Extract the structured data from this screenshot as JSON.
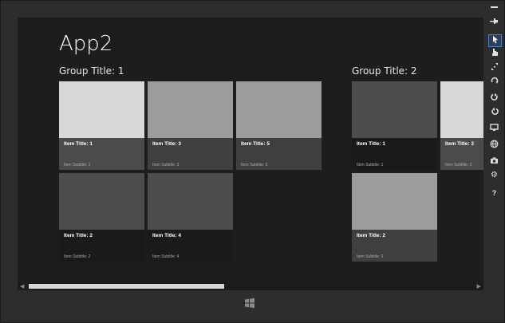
{
  "app": {
    "title": "App2"
  },
  "groups": [
    {
      "title": "Group Title: 1",
      "items": [
        {
          "title": "Item Title: 1",
          "subtitle": "Item Subtitle: 1",
          "img_color": "#d8d8d8",
          "cap_color": "#4b4b4b"
        },
        {
          "title": "Item Title: 3",
          "subtitle": "Item Subtitle: 3",
          "img_color": "#9c9c9c",
          "cap_color": "#3f3f3f"
        },
        {
          "title": "Item Title: 5",
          "subtitle": "Item Subtitle: 5",
          "img_color": "#9c9c9c",
          "cap_color": "#3f3f3f"
        },
        {
          "title": "Item Title: 2",
          "subtitle": "Item Subtitle: 2",
          "img_color": "#4d4d4d",
          "cap_color": "#1a1a1a"
        },
        {
          "title": "Item Title: 4",
          "subtitle": "Item Subtitle: 4",
          "img_color": "#4d4d4d",
          "cap_color": "#1a1a1a"
        }
      ]
    },
    {
      "title": "Group Title: 2",
      "items": [
        {
          "title": "Item Title: 1",
          "subtitle": "Item Subtitle: 1",
          "img_color": "#4d4d4d",
          "cap_color": "#1a1a1a"
        },
        {
          "title": "Item Title: 3",
          "subtitle": "Item Subtitle: 3",
          "img_color": "#d8d8d8",
          "cap_color": "#4b4b4b"
        },
        {
          "title": "Item Title: 2",
          "subtitle": "Item Subtitle: 2",
          "img_color": "#9c9c9c",
          "cap_color": "#3f3f3f"
        }
      ]
    }
  ],
  "scrollbar": {
    "position_fraction": 0.44
  },
  "toolbar_icons": [
    "minimize-icon",
    "pin-icon",
    "pointer-icon",
    "touch-icon",
    "pinch-icon",
    "rotate-touch-icon",
    "rotate-cw-icon",
    "rotate-ccw-icon",
    "resolution-icon",
    "globe-icon",
    "camera-icon",
    "settings-icon",
    "help-icon"
  ],
  "colors": {
    "background": "#1d1d1d",
    "text": "#ffffff",
    "active_tool_border": "#4a7fbf"
  }
}
